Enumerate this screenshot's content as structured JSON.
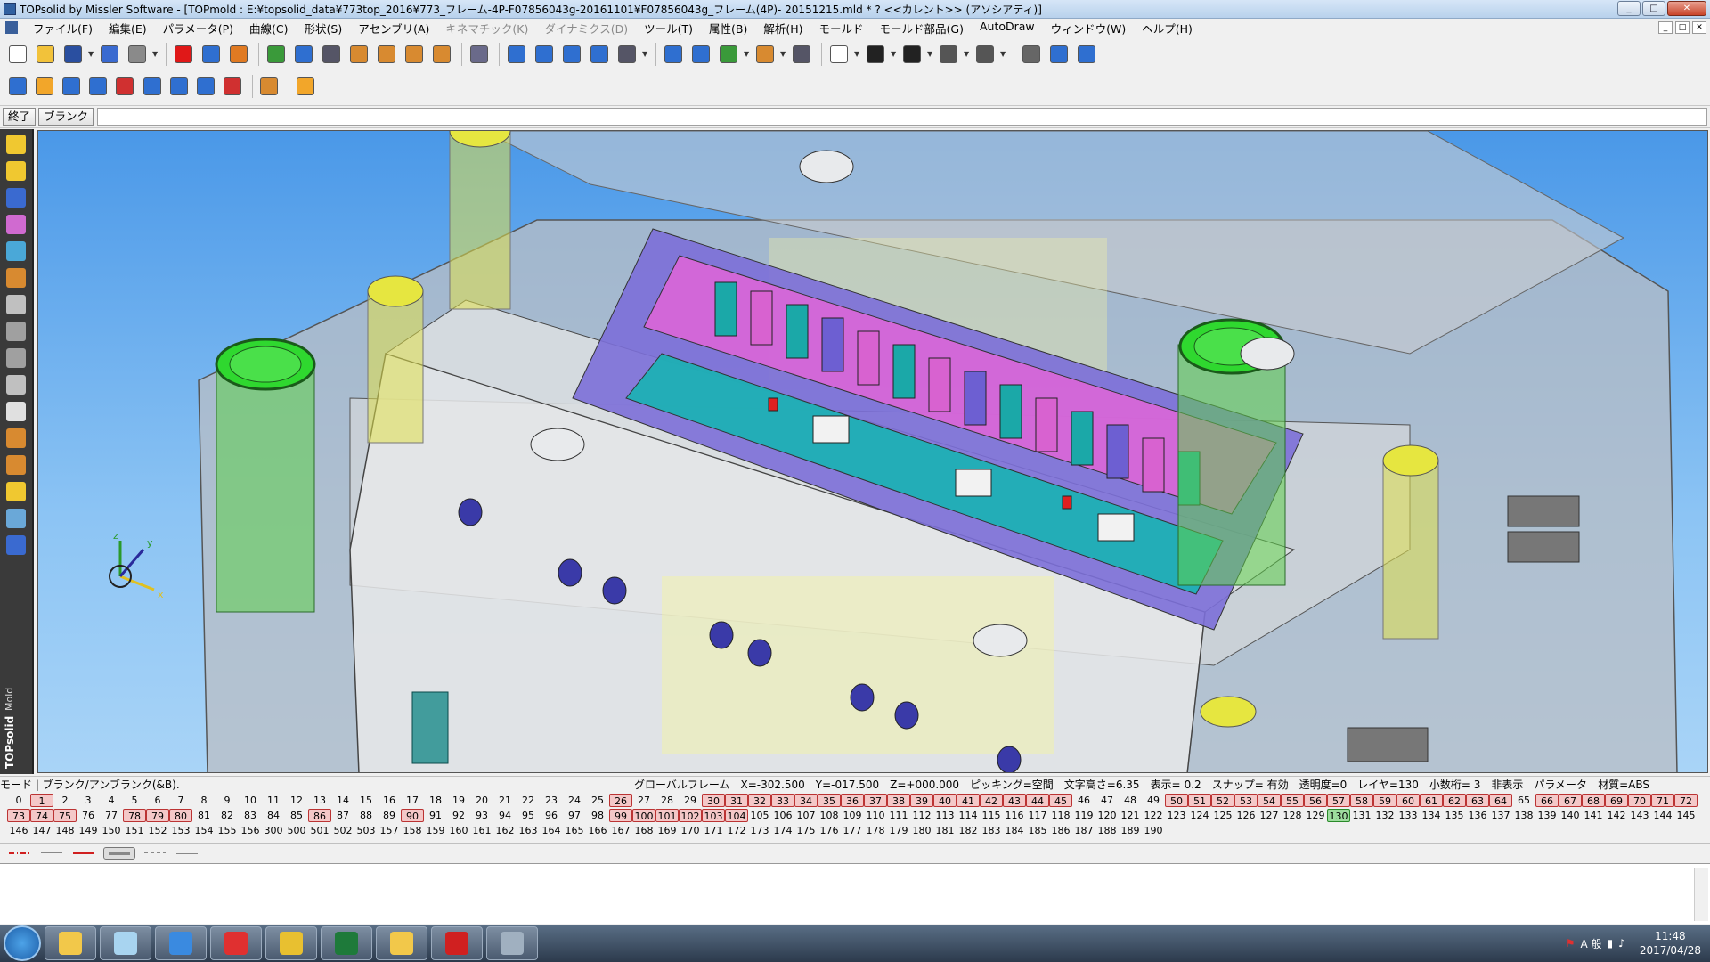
{
  "window": {
    "title": "TOPsolid by Missler Software - [TOPmold : E:¥topsolid_data¥773top_2016¥773_フレーム-4P-F07856043g-20161101¥F07856043g_フレーム(4P)- 20151215.mld * ?  <<カレント>> (アソシアティ)]",
    "minimize": "_",
    "maximize": "□",
    "close": "✕"
  },
  "menu": [
    {
      "label": "ファイル(F)",
      "enabled": true
    },
    {
      "label": "編集(E)",
      "enabled": true
    },
    {
      "label": "パラメータ(P)",
      "enabled": true
    },
    {
      "label": "曲線(C)",
      "enabled": true
    },
    {
      "label": "形状(S)",
      "enabled": true
    },
    {
      "label": "アセンブリ(A)",
      "enabled": true
    },
    {
      "label": "キネマチック(K)",
      "enabled": false
    },
    {
      "label": "ダイナミクス(D)",
      "enabled": false
    },
    {
      "label": "ツール(T)",
      "enabled": true
    },
    {
      "label": "属性(B)",
      "enabled": true
    },
    {
      "label": "解析(H)",
      "enabled": true
    },
    {
      "label": "モールド",
      "enabled": true
    },
    {
      "label": "モールド部品(G)",
      "enabled": true
    },
    {
      "label": "AutoDraw",
      "enabled": true
    },
    {
      "label": "ウィンドウ(W)",
      "enabled": true
    },
    {
      "label": "ヘルプ(H)",
      "enabled": true
    }
  ],
  "mdi_buttons": [
    "_",
    "□",
    "✕"
  ],
  "toolbar1_icons": [
    {
      "name": "new-document-icon",
      "color": "#ffffff"
    },
    {
      "name": "open-folder-icon",
      "color": "#f2c23a"
    },
    {
      "name": "save-icon",
      "color": "#2a4fa0"
    },
    {
      "name": "properties-icon",
      "color": "#3a6ad0"
    },
    {
      "name": "print-icon",
      "color": "#8a8a8a"
    },
    {
      "name": "delete-icon",
      "color": "#e01818"
    },
    {
      "name": "undo-icon",
      "color": "#2f6fd0"
    },
    {
      "name": "eraser-icon",
      "color": "#e07a22"
    },
    {
      "name": "regenerate-icon",
      "color": "#3a9a3a"
    },
    {
      "name": "view-icon",
      "color": "#2f6fd0"
    },
    {
      "name": "parameters-icon",
      "color": "#556"
    },
    {
      "name": "hand-icon",
      "color": "#d88a30"
    },
    {
      "name": "operation-icon",
      "color": "#d88a30"
    },
    {
      "name": "tool-icon",
      "color": "#d88a30"
    },
    {
      "name": "measure-icon",
      "color": "#d88a30"
    },
    {
      "name": "pointer-icon",
      "color": "#6a6a8a"
    },
    {
      "name": "curve-icon",
      "color": "#2f6fd0"
    },
    {
      "name": "trim-icon",
      "color": "#2f6fd0"
    },
    {
      "name": "distance-icon",
      "color": "#2f6fd0"
    },
    {
      "name": "arc-icon",
      "color": "#2f6fd0"
    },
    {
      "name": "axis-icon",
      "color": "#556"
    },
    {
      "name": "zoom-icon",
      "color": "#2f6fd0"
    },
    {
      "name": "zoom-fit-icon",
      "color": "#2f6fd0"
    },
    {
      "name": "pan-icon",
      "color": "#3a9a3a"
    },
    {
      "name": "rotate-icon",
      "color": "#d88a30"
    },
    {
      "name": "walk-icon",
      "color": "#556"
    },
    {
      "name": "color-swatch-icon",
      "color": "#ffffff"
    },
    {
      "name": "dot-icon",
      "color": "#222"
    },
    {
      "name": "point-style-icon",
      "color": "#222"
    },
    {
      "name": "line-style-icon",
      "color": "#555"
    },
    {
      "name": "hatch-icon",
      "color": "#555"
    },
    {
      "name": "camera-icon",
      "color": "#666"
    },
    {
      "name": "rendering-icon",
      "color": "#2f6fd0"
    },
    {
      "name": "shading-icon",
      "color": "#2f6fd0"
    }
  ],
  "toolbar2_icons": [
    {
      "name": "part-icon",
      "color": "#2f6fd0"
    },
    {
      "name": "block-icon",
      "color": "#f2a62a"
    },
    {
      "name": "plate-icon",
      "color": "#2f6fd0"
    },
    {
      "name": "insert-icon",
      "color": "#2f6fd0"
    },
    {
      "name": "ejector-icon",
      "color": "#d03030"
    },
    {
      "name": "slide-icon",
      "color": "#2f6fd0"
    },
    {
      "name": "cooling-icon",
      "color": "#2f6fd0"
    },
    {
      "name": "runner-icon",
      "color": "#2f6fd0"
    },
    {
      "name": "gate-icon",
      "color": "#d03030"
    },
    {
      "name": "pin-icon",
      "color": "#d88a30"
    },
    {
      "name": "library-icon",
      "color": "#f2a62a"
    }
  ],
  "command": {
    "end_label": "終了",
    "blank_label": "ブランク",
    "input_value": ""
  },
  "left_tools": [
    {
      "name": "sketch-icon",
      "color": "#f0c830"
    },
    {
      "name": "curve-tool-icon",
      "color": "#f0c830"
    },
    {
      "name": "solid-icon",
      "color": "#3a6ad0"
    },
    {
      "name": "surface-icon",
      "color": "#d06ad0"
    },
    {
      "name": "assembly-icon",
      "color": "#4aa8d8"
    },
    {
      "name": "mold-base-icon",
      "color": "#d88a30"
    },
    {
      "name": "components-icon",
      "color": "#c0c0c0"
    },
    {
      "name": "parting-icon",
      "color": "#a0a0a0"
    },
    {
      "name": "cavity-icon",
      "color": "#a0a0a0"
    },
    {
      "name": "screw-icon",
      "color": "#c0c0c0"
    },
    {
      "name": "spring-icon",
      "color": "#e0e0e0"
    },
    {
      "name": "ejector-pin-icon",
      "color": "#d88a30"
    },
    {
      "name": "cooling-tool-icon",
      "color": "#d88a30"
    },
    {
      "name": "electrode-icon",
      "color": "#f0c830"
    },
    {
      "name": "analysis-icon",
      "color": "#6aa8d8"
    },
    {
      "name": "mold-view-icon",
      "color": "#3a6ad0"
    }
  ],
  "brand": {
    "name": "TOPsolid",
    "sub": "Mold"
  },
  "axis_labels": {
    "x": "x",
    "y": "y",
    "z": "z"
  },
  "status": {
    "mode": "モード | ブランク/アンブランク(&B).",
    "frame": "グローバルフレーム",
    "x": "X=-302.500",
    "y": "Y=-017.500",
    "z": "Z=+000.000",
    "picking": "ピッキング=空間",
    "text_height": "文字高さ=6.35",
    "display": "表示=",
    "display_value": "0.2",
    "snap": "スナップ= 有効",
    "transparency": "透明度=0",
    "layer": "レイヤ=130",
    "decimals": "小数桁= 3",
    "hide": "非表示",
    "parameter": "パラメータ",
    "material": "材質=ABS"
  },
  "layers": {
    "rows": [
      [
        "0",
        "1",
        "2",
        "3",
        "4",
        "5",
        "6",
        "7",
        "8",
        "9",
        "10",
        "11",
        "12",
        "13",
        "14",
        "15",
        "16",
        "17",
        "18",
        "19",
        "20",
        "21",
        "22",
        "23",
        "24",
        "25",
        "26",
        "27",
        "28",
        "29",
        "30",
        "31",
        "32",
        "33",
        "34",
        "35",
        "36",
        "37",
        "38",
        "39",
        "40",
        "41",
        "42",
        "43",
        "44",
        "45",
        "46",
        "47",
        "48",
        "49",
        "50",
        "51",
        "52",
        "53",
        "54",
        "55",
        "56",
        "57",
        "58",
        "59",
        "60",
        "61",
        "62",
        "63",
        "64",
        "65",
        "66",
        "67",
        "68",
        "69",
        "70",
        "71",
        "72"
      ],
      [
        "73",
        "74",
        "75",
        "76",
        "77",
        "78",
        "79",
        "80",
        "81",
        "82",
        "83",
        "84",
        "85",
        "86",
        "87",
        "88",
        "89",
        "90",
        "91",
        "92",
        "93",
        "94",
        "95",
        "96",
        "97",
        "98",
        "99",
        "100",
        "101",
        "102",
        "103",
        "104",
        "105",
        "106",
        "107",
        "108",
        "109",
        "110",
        "111",
        "112",
        "113",
        "114",
        "115",
        "116",
        "117",
        "118",
        "119",
        "120",
        "121",
        "122",
        "123",
        "124",
        "125",
        "126",
        "127",
        "128",
        "129",
        "130",
        "131",
        "132",
        "133",
        "134",
        "135",
        "136",
        "137",
        "138",
        "139",
        "140",
        "141",
        "142",
        "143",
        "144",
        "145"
      ],
      [
        "146",
        "147",
        "148",
        "149",
        "150",
        "151",
        "152",
        "153",
        "154",
        "155",
        "156",
        "300",
        "500",
        "501",
        "502",
        "503",
        "157",
        "158",
        "159",
        "160",
        "161",
        "162",
        "163",
        "164",
        "165",
        "166",
        "167",
        "168",
        "169",
        "170",
        "171",
        "172",
        "173",
        "174",
        "175",
        "176",
        "177",
        "178",
        "179",
        "180",
        "181",
        "182",
        "183",
        "184",
        "185",
        "186",
        "187",
        "188",
        "189",
        "190"
      ]
    ],
    "active": [
      "1",
      "26",
      "30",
      "31",
      "32",
      "33",
      "34",
      "35",
      "36",
      "37",
      "38",
      "39",
      "40",
      "41",
      "42",
      "43",
      "44",
      "45",
      "50",
      "51",
      "52",
      "53",
      "54",
      "55",
      "56",
      "57",
      "58",
      "59",
      "60",
      "61",
      "62",
      "63",
      "64",
      "66",
      "67",
      "68",
      "69",
      "70",
      "71",
      "72",
      "73",
      "74",
      "75",
      "78",
      "79",
      "80",
      "86",
      "90",
      "99",
      "100",
      "101",
      "102",
      "103",
      "104"
    ],
    "current": "130"
  },
  "taskbar": {
    "apps": [
      {
        "name": "explorer-icon",
        "color": "#f2c84a"
      },
      {
        "name": "notepad-icon",
        "color": "#a8d4f0"
      },
      {
        "name": "internet-explorer-icon",
        "color": "#3a8ae0"
      },
      {
        "name": "topsolid-icon",
        "color": "#e03030"
      },
      {
        "name": "chrome-icon",
        "color": "#e8c030"
      },
      {
        "name": "excel-icon",
        "color": "#1e7a3a"
      },
      {
        "name": "file-manager-icon",
        "color": "#f2c84a"
      },
      {
        "name": "pdf-icon",
        "color": "#d02020"
      },
      {
        "name": "settings-app-icon",
        "color": "#a0b0c0"
      }
    ],
    "ime": "A 般",
    "time": "11:48",
    "date": "2017/04/28"
  }
}
